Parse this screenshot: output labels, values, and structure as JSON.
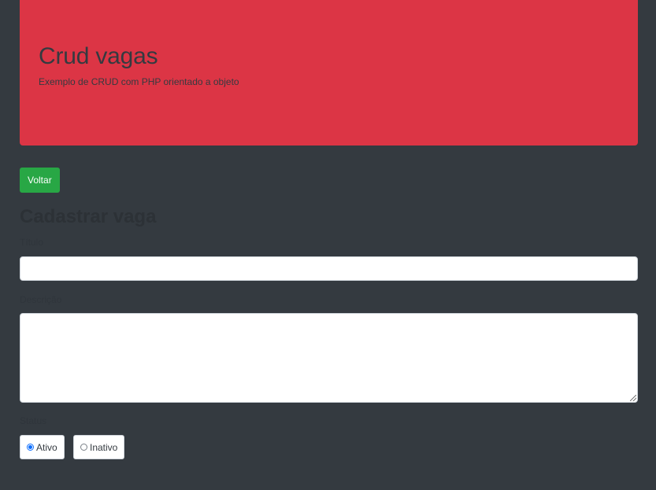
{
  "header": {
    "title": "Crud vagas",
    "subtitle": "Exemplo de CRUD com PHP orientado a objeto",
    "background_color": "#dc3545"
  },
  "actions": {
    "back_label": "Voltar",
    "back_color": "#28a745"
  },
  "form": {
    "heading": "Cadastrar vaga",
    "title_label": "Título",
    "title_value": "",
    "description_label": "Descrição",
    "description_value": "",
    "status_label": "Status",
    "status_options": [
      {
        "label": "Ativo",
        "selected": true
      },
      {
        "label": "Inativo",
        "selected": false
      }
    ]
  },
  "colors": {
    "page_background": "#343a40",
    "accent": "#0d6efd"
  }
}
